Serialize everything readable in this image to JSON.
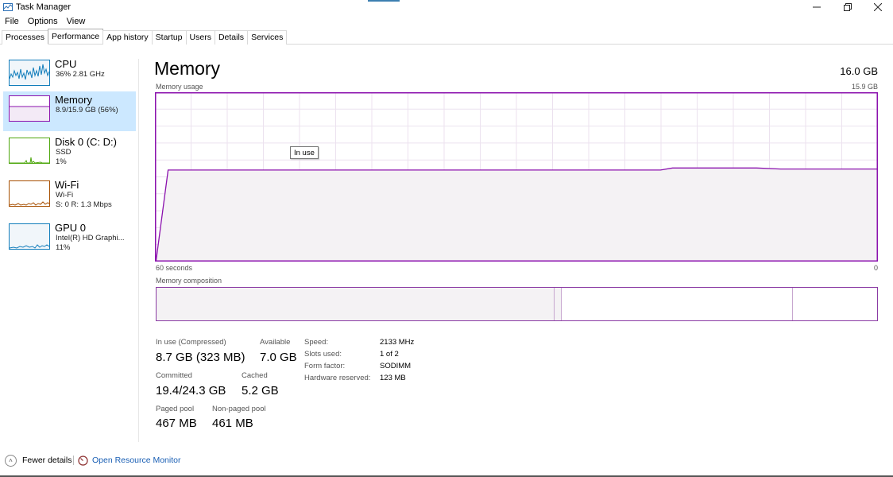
{
  "window": {
    "title": "Task Manager"
  },
  "menu": [
    "File",
    "Options",
    "View"
  ],
  "tabs": [
    "Processes",
    "Performance",
    "App history",
    "Startup",
    "Users",
    "Details",
    "Services"
  ],
  "active_tab": "Performance",
  "sidebar": [
    {
      "name": "CPU",
      "sub1": "36% 2.81 GHz",
      "sub2": "",
      "color": "#117dbb"
    },
    {
      "name": "Memory",
      "sub1": "8.9/15.9 GB (56%)",
      "sub2": "",
      "color": "#8b12ae"
    },
    {
      "name": "Disk 0 (C: D:)",
      "sub1": "SSD",
      "sub2": "1%",
      "color": "#4da60c"
    },
    {
      "name": "Wi-Fi",
      "sub1": "Wi-Fi",
      "sub2": "S: 0 R: 1.3 Mbps",
      "color": "#a74f01"
    },
    {
      "name": "GPU 0",
      "sub1": "Intel(R) HD Graphi...",
      "sub2": "11%",
      "color": "#117dbb"
    }
  ],
  "main": {
    "title": "Memory",
    "total": "16.0 GB",
    "usage_label": "Memory usage",
    "usage_max": "15.9 GB",
    "x_start_label": "60 seconds",
    "x_end_label": "0",
    "tooltip": "In use",
    "composition_label": "Memory composition"
  },
  "stats": {
    "in_use_label": "In use (Compressed)",
    "in_use_value": "8.7 GB (323 MB)",
    "available_label": "Available",
    "available_value": "7.0 GB",
    "committed_label": "Committed",
    "committed_value": "19.4/24.3 GB",
    "cached_label": "Cached",
    "cached_value": "5.2 GB",
    "paged_label": "Paged pool",
    "paged_value": "467 MB",
    "nonpaged_label": "Non-paged pool",
    "nonpaged_value": "461 MB"
  },
  "specs": [
    {
      "label": "Speed:",
      "value": "2133 MHz"
    },
    {
      "label": "Slots used:",
      "value": "1 of 2"
    },
    {
      "label": "Form factor:",
      "value": "SODIMM"
    },
    {
      "label": "Hardware reserved:",
      "value": "123 MB"
    }
  ],
  "footer": {
    "fewer_details": "Fewer details",
    "resource_monitor": "Open Resource Monitor"
  },
  "chart_data": {
    "type": "area",
    "title": "Memory usage",
    "xlabel": "",
    "ylabel": "",
    "x_label_left": "60 seconds",
    "x_label_right": "0",
    "ylim": [
      0,
      15.9
    ],
    "y_unit": "GB",
    "color": "#8b12ae",
    "grid": true,
    "x": [
      60,
      59,
      55,
      50,
      45,
      40,
      35,
      30,
      25,
      20,
      18,
      17,
      15,
      10,
      8,
      5,
      0
    ],
    "values": [
      0.0,
      8.6,
      8.6,
      8.6,
      8.6,
      8.6,
      8.6,
      8.6,
      8.6,
      8.6,
      8.6,
      8.8,
      8.8,
      8.8,
      8.7,
      8.7,
      8.7
    ]
  }
}
